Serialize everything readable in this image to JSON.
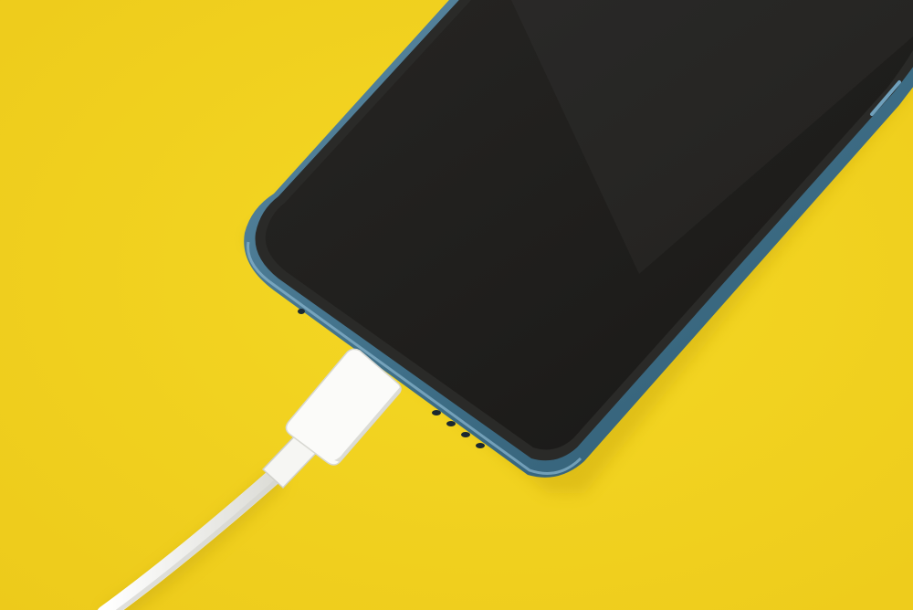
{
  "photo": {
    "subject": "",
    "colors": {
      "background": "#f2d21e",
      "background_shadow": "#e4c214",
      "phone_frame": "#3f6f88",
      "phone_frame_highlight": "#6fa0bc",
      "screen": "#1f1e1c",
      "bezel": "#2a2a28",
      "cable": "#f7f7f5",
      "cable_shade": "#d9d9d4"
    }
  }
}
